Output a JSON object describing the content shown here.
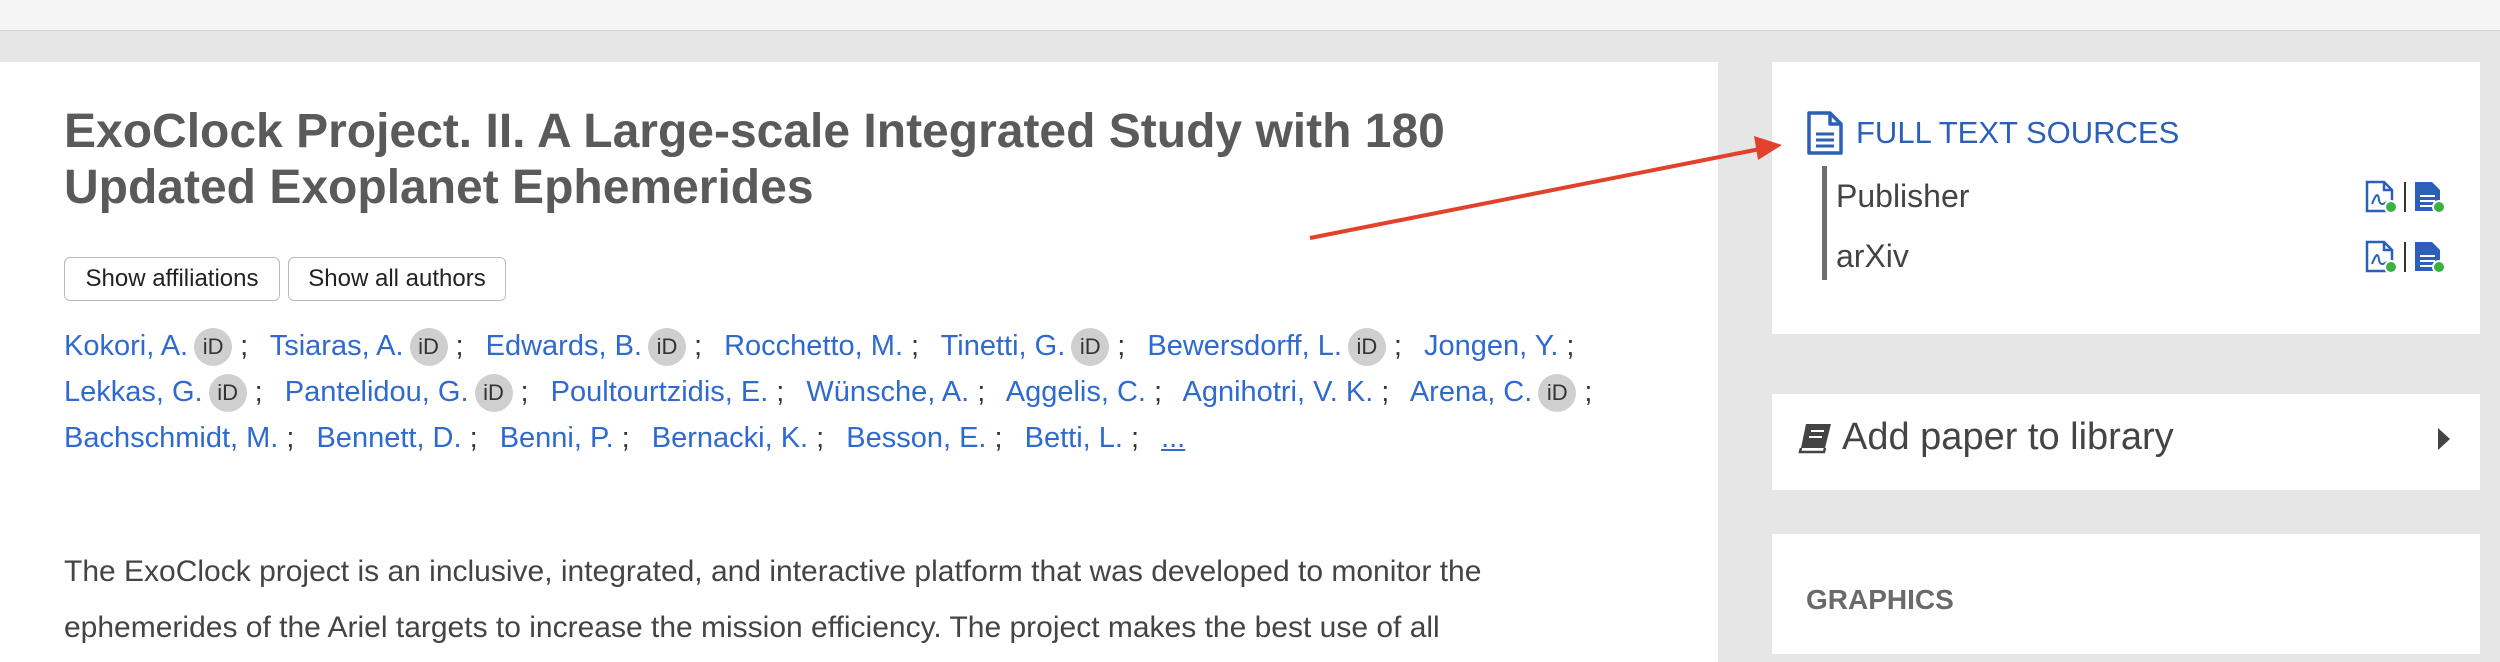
{
  "paper": {
    "title_line1": "ExoClock Project. II. A Large-scale Integrated Study with 180",
    "title_line2": "Updated Exoplanet Ephemerides"
  },
  "buttons": {
    "show_affiliations": "Show affiliations",
    "show_all_authors": "Show all authors"
  },
  "authors": [
    {
      "name": "Kokori, A.",
      "orcid": true
    },
    {
      "name": "Tsiaras, A.",
      "orcid": true
    },
    {
      "name": "Edwards, B.",
      "orcid": true
    },
    {
      "name": "Rocchetto, M.",
      "orcid": false
    },
    {
      "name": "Tinetti, G.",
      "orcid": true
    },
    {
      "name": "Bewersdorff, L.",
      "orcid": true
    },
    {
      "name": "Jongen, Y.",
      "orcid": false
    },
    {
      "name": "Lekkas, G.",
      "orcid": true
    },
    {
      "name": "Pantelidou, G.",
      "orcid": true
    },
    {
      "name": "Poultourtzidis, E.",
      "orcid": false
    },
    {
      "name": "Wünsche, A.",
      "orcid": false
    },
    {
      "name": "Aggelis, C.",
      "orcid": false
    },
    {
      "name": "Agnihotri, V. K.",
      "orcid": false
    },
    {
      "name": "Arena, C.",
      "orcid": true
    },
    {
      "name": "Bachschmidt, M.",
      "orcid": false
    },
    {
      "name": "Bennett, D.",
      "orcid": false
    },
    {
      "name": "Benni, P.",
      "orcid": false
    },
    {
      "name": "Bernacki, K.",
      "orcid": false
    },
    {
      "name": "Besson, E.",
      "orcid": false
    },
    {
      "name": "Betti, L.",
      "orcid": false
    }
  ],
  "authors_more": "...",
  "orcid_badge": "iD",
  "separator": ";",
  "abstract": {
    "line1": "The ExoClock project is an inclusive, integrated, and interactive platform that was developed to monitor the",
    "line2": "ephemerides of the Ariel targets to increase the mission efficiency. The project makes the best use of all"
  },
  "full_text_sources": {
    "header": "FULL TEXT SOURCES",
    "sources": [
      {
        "label": "Publisher"
      },
      {
        "label": "arXiv"
      }
    ]
  },
  "library": {
    "label": "Add paper to library"
  },
  "graphics": {
    "label": "GRAPHICS"
  },
  "colors": {
    "link": "#2e6acf",
    "arrow": "#e2412b",
    "icon_blue": "#2b5fb8",
    "icon_green": "#3cb043"
  }
}
